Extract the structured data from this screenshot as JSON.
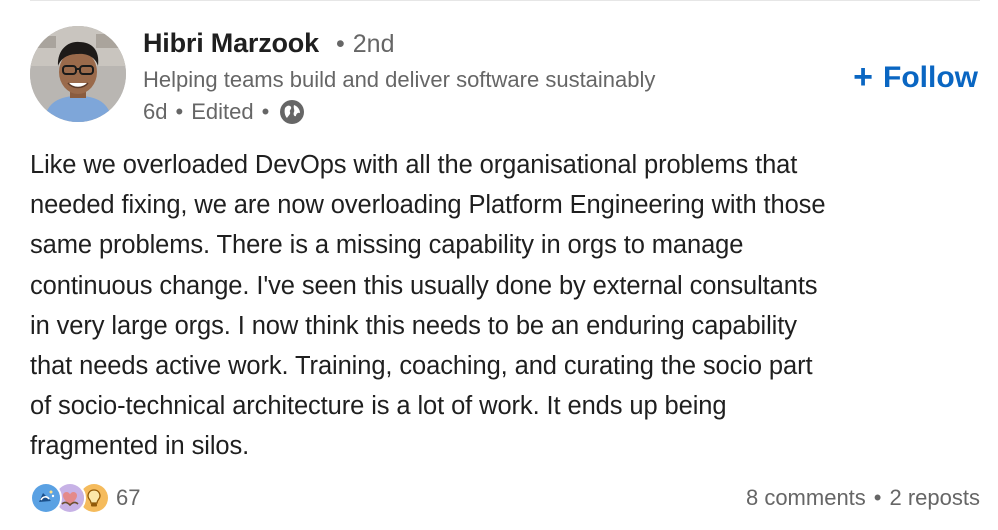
{
  "author": {
    "name": "Hibri Marzook",
    "degree": "2nd",
    "headline": "Helping teams build and deliver software sustainably",
    "posted_age": "6d",
    "edited_label": "Edited",
    "visibility_icon": "globe-icon"
  },
  "follow": {
    "label": "Follow",
    "icon": "plus-icon",
    "color": "#0a66c2"
  },
  "post": {
    "text": "Like we overloaded DevOps with all the organisational problems that\nneeded fixing, we are now overloading Platform Engineering with those\nsame problems. There is a missing capability in orgs to manage\ncontinuous change. I've seen this usually done by external consultants\nin very large orgs. I now think this needs to be an enduring capability\nthat needs active work. Training, coaching, and curating the socio part\nof socio-technical architecture is a lot of work. It ends up being\nfragmented in silos."
  },
  "engagement": {
    "reaction_icons": [
      "celebrate-icon",
      "support-icon",
      "insightful-icon"
    ],
    "reaction_count": "67",
    "comments": "8 comments",
    "reposts": "2 reposts"
  },
  "colors": {
    "muted_text": "#666666",
    "body_text": "#1f1f1f",
    "accent": "#0a66c2"
  }
}
